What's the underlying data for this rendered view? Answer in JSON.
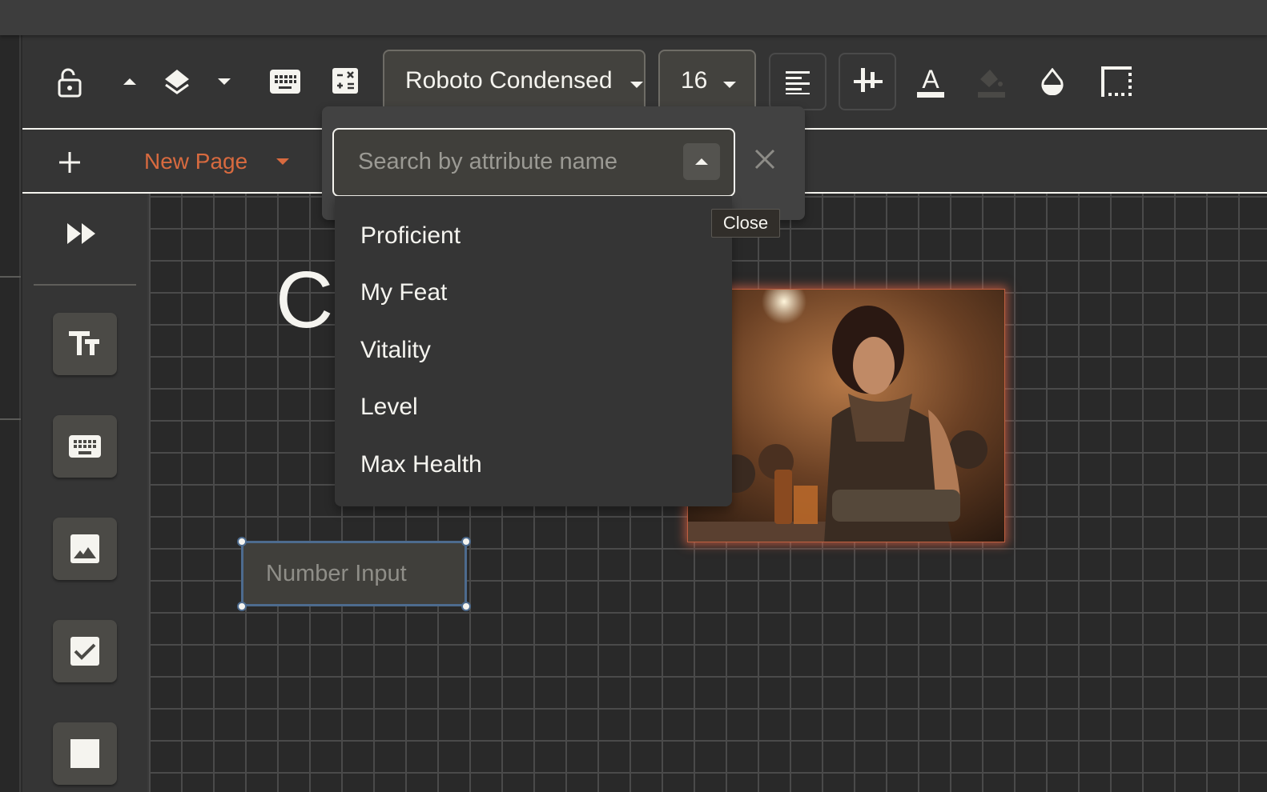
{
  "toolbar": {
    "lock_icon": "lock-open-icon",
    "layer_up_icon": "caret-up-icon",
    "layers_icon": "layers-icon",
    "layer_down_icon": "caret-down-icon",
    "keyboard_icon": "keyboard-icon",
    "calculator_icon": "calculator-icon",
    "font_family": "Roboto Condensed",
    "font_size": "16",
    "align_icon": "align-left-icon",
    "spacing_icon": "letter-spacing-icon",
    "text_color_icon": "text-color-icon",
    "fill_color_icon": "fill-color-icon",
    "opacity_icon": "opacity-icon",
    "border_icon": "border-style-icon"
  },
  "pagebar": {
    "add_icon": "plus-icon",
    "page_name": "New Page",
    "accent_color": "#d86a3f"
  },
  "sidebar": {
    "collapse_icon": "fast-forward-icon",
    "tools": [
      {
        "name": "text-tool",
        "icon": "text-size-icon"
      },
      {
        "name": "input-tool",
        "icon": "keyboard-icon"
      },
      {
        "name": "image-tool",
        "icon": "image-icon"
      },
      {
        "name": "checkbox-tool",
        "icon": "checkbox-icon"
      },
      {
        "name": "shape-tool",
        "icon": "square-icon"
      }
    ]
  },
  "attribute_search": {
    "placeholder": "Search by attribute name",
    "value": "",
    "close_tooltip": "Close",
    "options": [
      "Proficient",
      "My Feat",
      "Vitality",
      "Level",
      "Max Health"
    ]
  },
  "canvas": {
    "heading_text": "C",
    "number_input_placeholder": "Number Input",
    "selection_color": "#4d6b8e"
  }
}
